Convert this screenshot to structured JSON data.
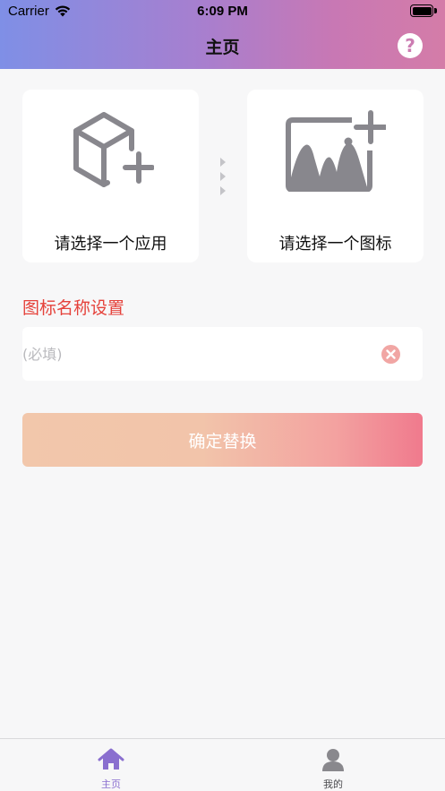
{
  "status_bar": {
    "carrier": "Carrier",
    "time": "6:09 PM",
    "icons": [
      "wifi-icon",
      "battery-icon"
    ]
  },
  "nav": {
    "title": "主页",
    "help_icon": "question-circle-icon",
    "help_label": "?"
  },
  "pickers": {
    "app": {
      "label": "请选择一个应用",
      "icon": "cube-plus-icon"
    },
    "connector_icon": "triple-chevron-arrows-icon",
    "icon": {
      "label": "请选择一个图标",
      "icon": "image-plus-icon"
    }
  },
  "name_section": {
    "title": "图标名称设置",
    "input_value": "",
    "input_placeholder": "(必填)",
    "clear_icon": "clear-x-circle-icon"
  },
  "confirm": {
    "label": "确定替换"
  },
  "tab_bar": {
    "tabs": [
      {
        "label": "主页",
        "icon": "home-icon",
        "active": true
      },
      {
        "label": "我的",
        "icon": "person-icon",
        "active": false
      }
    ]
  },
  "colors": {
    "header_gradient_start": "#7f8fe6",
    "header_gradient_end": "#d47ca8",
    "section_title": "#e5423b",
    "accent_active_tab": "#8a6fcf",
    "button_gradient_start": "#f2c7ab",
    "button_gradient_end": "#f07a8d"
  }
}
